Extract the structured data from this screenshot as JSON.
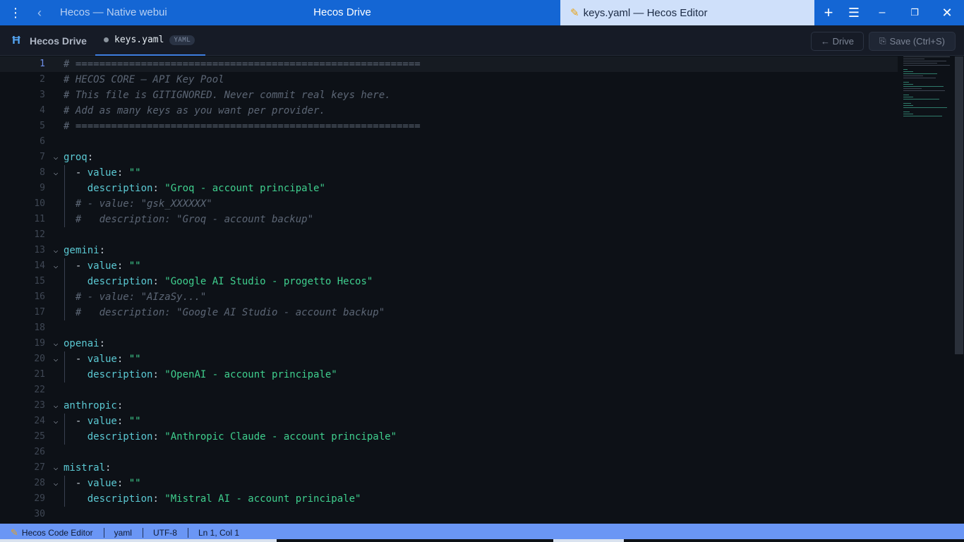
{
  "titlebar": {
    "tab1": "Hecos — Native webui",
    "tab2": "Hecos Drive",
    "tab3": "keys.yaml — Hecos Editor"
  },
  "toolbar": {
    "brand": "Hecos Drive",
    "file_tab": "keys.yaml",
    "file_badge": "YAML",
    "drive_button": "← Drive",
    "save_button": "Save (Ctrl+S)"
  },
  "editor": {
    "active_line": 1,
    "lines": [
      {
        "n": "1",
        "fold": false,
        "indent": 0,
        "parts": [
          {
            "t": "# ==========================================================",
            "c": "c-com"
          }
        ]
      },
      {
        "n": "2",
        "fold": false,
        "indent": 0,
        "parts": [
          {
            "t": "# HECOS CORE — API Key Pool",
            "c": "c-com"
          }
        ]
      },
      {
        "n": "3",
        "fold": false,
        "indent": 0,
        "parts": [
          {
            "t": "# This file is GITIGNORED. Never commit real keys here.",
            "c": "c-com"
          }
        ]
      },
      {
        "n": "4",
        "fold": false,
        "indent": 0,
        "parts": [
          {
            "t": "# Add as many keys as you want per provider.",
            "c": "c-com"
          }
        ]
      },
      {
        "n": "5",
        "fold": false,
        "indent": 0,
        "parts": [
          {
            "t": "# ==========================================================",
            "c": "c-com"
          }
        ]
      },
      {
        "n": "6",
        "fold": false,
        "indent": 0,
        "parts": []
      },
      {
        "n": "7",
        "fold": true,
        "indent": 0,
        "parts": [
          {
            "t": "groq",
            "c": "c-key"
          },
          {
            "t": ":",
            "c": "c-punc"
          }
        ]
      },
      {
        "n": "8",
        "fold": true,
        "indent": 1,
        "parts": [
          {
            "t": "  - ",
            "c": "c-punc"
          },
          {
            "t": "value",
            "c": "c-key"
          },
          {
            "t": ": ",
            "c": "c-punc"
          },
          {
            "t": "\"\"",
            "c": "c-str"
          }
        ]
      },
      {
        "n": "9",
        "fold": false,
        "indent": 1,
        "parts": [
          {
            "t": "    description",
            "c": "c-key"
          },
          {
            "t": ": ",
            "c": "c-punc"
          },
          {
            "t": "\"Groq - account principale\"",
            "c": "c-str"
          }
        ]
      },
      {
        "n": "10",
        "fold": false,
        "indent": 1,
        "parts": [
          {
            "t": "  # - value: \"gsk_XXXXXX\"",
            "c": "c-com"
          }
        ]
      },
      {
        "n": "11",
        "fold": false,
        "indent": 1,
        "parts": [
          {
            "t": "  #   description: \"Groq - account backup\"",
            "c": "c-com"
          }
        ]
      },
      {
        "n": "12",
        "fold": false,
        "indent": 0,
        "parts": []
      },
      {
        "n": "13",
        "fold": true,
        "indent": 0,
        "parts": [
          {
            "t": "gemini",
            "c": "c-key"
          },
          {
            "t": ":",
            "c": "c-punc"
          }
        ]
      },
      {
        "n": "14",
        "fold": true,
        "indent": 1,
        "parts": [
          {
            "t": "  - ",
            "c": "c-punc"
          },
          {
            "t": "value",
            "c": "c-key"
          },
          {
            "t": ": ",
            "c": "c-punc"
          },
          {
            "t": "\"\"",
            "c": "c-str"
          }
        ]
      },
      {
        "n": "15",
        "fold": false,
        "indent": 1,
        "parts": [
          {
            "t": "    description",
            "c": "c-key"
          },
          {
            "t": ": ",
            "c": "c-punc"
          },
          {
            "t": "\"Google AI Studio - progetto Hecos\"",
            "c": "c-str"
          }
        ]
      },
      {
        "n": "16",
        "fold": false,
        "indent": 1,
        "parts": [
          {
            "t": "  # - value: \"AIzaSy...\"",
            "c": "c-com"
          }
        ]
      },
      {
        "n": "17",
        "fold": false,
        "indent": 1,
        "parts": [
          {
            "t": "  #   description: \"Google AI Studio - account backup\"",
            "c": "c-com"
          }
        ]
      },
      {
        "n": "18",
        "fold": false,
        "indent": 0,
        "parts": []
      },
      {
        "n": "19",
        "fold": true,
        "indent": 0,
        "parts": [
          {
            "t": "openai",
            "c": "c-key"
          },
          {
            "t": ":",
            "c": "c-punc"
          }
        ]
      },
      {
        "n": "20",
        "fold": true,
        "indent": 1,
        "parts": [
          {
            "t": "  - ",
            "c": "c-punc"
          },
          {
            "t": "value",
            "c": "c-key"
          },
          {
            "t": ": ",
            "c": "c-punc"
          },
          {
            "t": "\"\"",
            "c": "c-str"
          }
        ]
      },
      {
        "n": "21",
        "fold": false,
        "indent": 1,
        "parts": [
          {
            "t": "    description",
            "c": "c-key"
          },
          {
            "t": ": ",
            "c": "c-punc"
          },
          {
            "t": "\"OpenAI - account principale\"",
            "c": "c-str"
          }
        ]
      },
      {
        "n": "22",
        "fold": false,
        "indent": 0,
        "parts": []
      },
      {
        "n": "23",
        "fold": true,
        "indent": 0,
        "parts": [
          {
            "t": "anthropic",
            "c": "c-key"
          },
          {
            "t": ":",
            "c": "c-punc"
          }
        ]
      },
      {
        "n": "24",
        "fold": true,
        "indent": 1,
        "parts": [
          {
            "t": "  - ",
            "c": "c-punc"
          },
          {
            "t": "value",
            "c": "c-key"
          },
          {
            "t": ": ",
            "c": "c-punc"
          },
          {
            "t": "\"\"",
            "c": "c-str"
          }
        ]
      },
      {
        "n": "25",
        "fold": false,
        "indent": 1,
        "parts": [
          {
            "t": "    description",
            "c": "c-key"
          },
          {
            "t": ": ",
            "c": "c-punc"
          },
          {
            "t": "\"Anthropic Claude - account principale\"",
            "c": "c-str"
          }
        ]
      },
      {
        "n": "26",
        "fold": false,
        "indent": 0,
        "parts": []
      },
      {
        "n": "27",
        "fold": true,
        "indent": 0,
        "parts": [
          {
            "t": "mistral",
            "c": "c-key"
          },
          {
            "t": ":",
            "c": "c-punc"
          }
        ]
      },
      {
        "n": "28",
        "fold": true,
        "indent": 1,
        "parts": [
          {
            "t": "  - ",
            "c": "c-punc"
          },
          {
            "t": "value",
            "c": "c-key"
          },
          {
            "t": ": ",
            "c": "c-punc"
          },
          {
            "t": "\"\"",
            "c": "c-str"
          }
        ]
      },
      {
        "n": "29",
        "fold": false,
        "indent": 1,
        "parts": [
          {
            "t": "    description",
            "c": "c-key"
          },
          {
            "t": ": ",
            "c": "c-punc"
          },
          {
            "t": "\"Mistral AI - account principale\"",
            "c": "c-str"
          }
        ]
      },
      {
        "n": "30",
        "fold": false,
        "indent": 0,
        "parts": []
      }
    ]
  },
  "statusbar": {
    "app": "Hecos Code Editor",
    "language": "yaml",
    "encoding": "UTF-8",
    "position": "Ln 1, Col 1"
  },
  "colors": {
    "titlebar": "#1466d4",
    "statusbar": "#6a96f5",
    "string": "#3fcf8e",
    "key": "#5bc9d3",
    "comment": "#5c6675"
  }
}
